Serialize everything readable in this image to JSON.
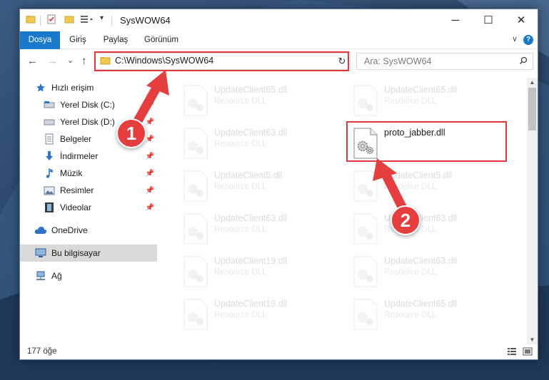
{
  "window": {
    "title": "SysWOW64",
    "controls": {
      "minimize": "─",
      "maximize": "☐",
      "close": "✕"
    }
  },
  "ribbon": {
    "tabs": [
      {
        "label": "Dosya",
        "active": true
      },
      {
        "label": "Giriş"
      },
      {
        "label": "Paylaş"
      },
      {
        "label": "Görünüm"
      }
    ],
    "collapse_glyph": "∨",
    "help_glyph": "?"
  },
  "navigation": {
    "back_glyph": "←",
    "forward_glyph": "→",
    "recent_glyph": "⌄",
    "up_glyph": "↑",
    "address": "C:\\Windows\\SysWOW64",
    "refresh_glyph": "↻",
    "search_placeholder": "Ara: SysWOW64",
    "search_glyph": "⚲"
  },
  "sidebar": {
    "items": [
      {
        "label": "Hızlı erişim",
        "icon": "star-icon"
      },
      {
        "label": "Yerel Disk (C:)",
        "icon": "drive-icon",
        "pinned": true
      },
      {
        "label": "Yerel Disk (D:)",
        "icon": "drive-icon",
        "pinned": true
      },
      {
        "label": "Belgeler",
        "icon": "documents-icon",
        "pinned": true
      },
      {
        "label": "İndirmeler",
        "icon": "download-icon",
        "pinned": true
      },
      {
        "label": "Müzik",
        "icon": "music-icon",
        "pinned": true
      },
      {
        "label": "Resimler",
        "icon": "pictures-icon",
        "pinned": true
      },
      {
        "label": "Videolar",
        "icon": "videos-icon",
        "pinned": true
      },
      {
        "label": "OneDrive",
        "icon": "cloud-icon"
      },
      {
        "label": "Bu bilgisayar",
        "icon": "computer-icon",
        "selected": true
      },
      {
        "label": "Ağ",
        "icon": "network-icon"
      }
    ],
    "pin_glyph": "📌"
  },
  "files": {
    "left_column": [
      {
        "name": "UpdateClient65.dll",
        "type": "Resource DLL"
      },
      {
        "name": "UpdateClient63.dll",
        "type": "Resource DLL"
      },
      {
        "name": "UpdateClient5.dll",
        "type": "Resource DLL"
      },
      {
        "name": "UpdateClient63.dll",
        "type": "Resource DLL"
      },
      {
        "name": "UpdateClient19.dll",
        "type": "Resource DLL"
      },
      {
        "name": "UpdateClient19.dll",
        "type": "Resource DLL"
      }
    ],
    "right_column": [
      {
        "name": "UpdateClient65.dll",
        "type": "Resource DLL"
      },
      {
        "name": "proto_jabber.dll",
        "type": ""
      },
      {
        "name": "UpdateClient5.dll",
        "type": "Resource DLL"
      },
      {
        "name": "UpdateClient63.dll",
        "type": "Resource DLL"
      },
      {
        "name": "UpdateClient63.dll",
        "type": "Resource DLL"
      },
      {
        "name": "UpdateClient65.dll",
        "type": "Resource DLL"
      }
    ]
  },
  "status": {
    "count": "177 öğe"
  },
  "annotations": {
    "step1": "1",
    "step2": "2",
    "color": "#e53e3e"
  },
  "colors": {
    "accent": "#1979ca",
    "highlight": "#e0393e"
  }
}
